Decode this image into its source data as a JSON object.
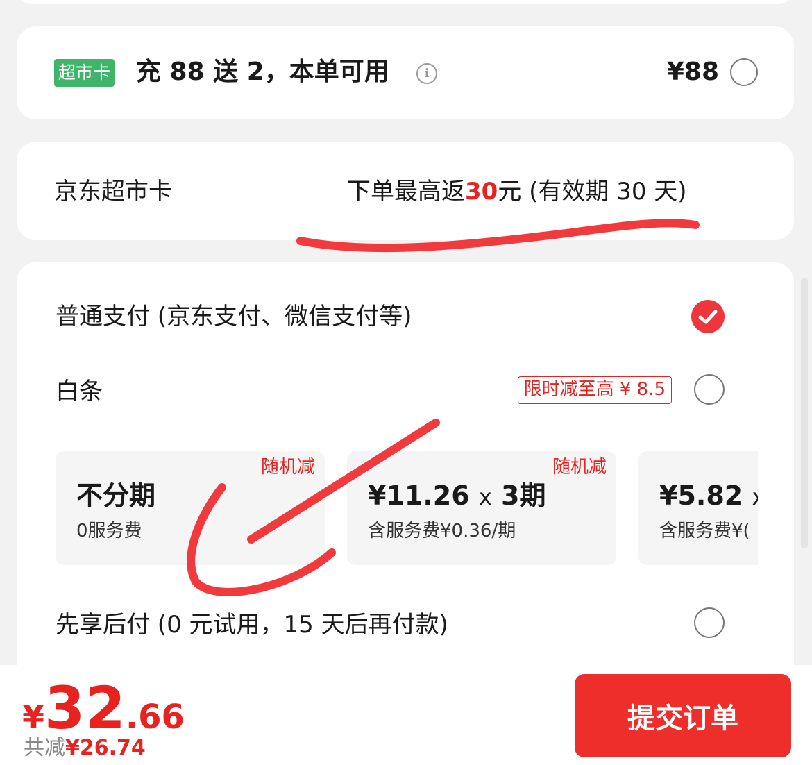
{
  "supermarket_offer": {
    "badge": "超市卡",
    "title": "充 88 送 2，本单可用",
    "info_icon": "info-circle-icon",
    "price": "¥88"
  },
  "jd_card": {
    "name": "京东超市卡",
    "desc_prefix": "下单最高返",
    "desc_highlight": "30",
    "desc_suffix": "元 (有效期 30 天)"
  },
  "payment": {
    "normal_label": "普通支付 (京东支付、微信支付等)",
    "baitiao_label": "白条",
    "baitiao_promo": "限时减至高 ¥ 8.5",
    "pay_later_label": "先享后付 (0 元试用，15 天后再付款)",
    "plans": [
      {
        "tag": "随机减",
        "main": "不分期",
        "sub": "0服务费"
      },
      {
        "tag": "随机减",
        "amount": "¥11.26",
        "times": "x",
        "periods": "3期",
        "sub": "含服务费¥0.36/期"
      },
      {
        "amount": "¥5.82",
        "times": "x",
        "sub": "含服务费¥("
      }
    ]
  },
  "bottom": {
    "currency": "¥",
    "total_int": "32",
    "total_dec": ".66",
    "saved_label": "共减",
    "saved_amount": "¥26.74",
    "submit_label": "提交订单"
  },
  "colors": {
    "accent_red": "#e8231f",
    "badge_green": "#3fb56a",
    "card_bg": "#ffffff",
    "page_bg": "#f2f2f2"
  }
}
